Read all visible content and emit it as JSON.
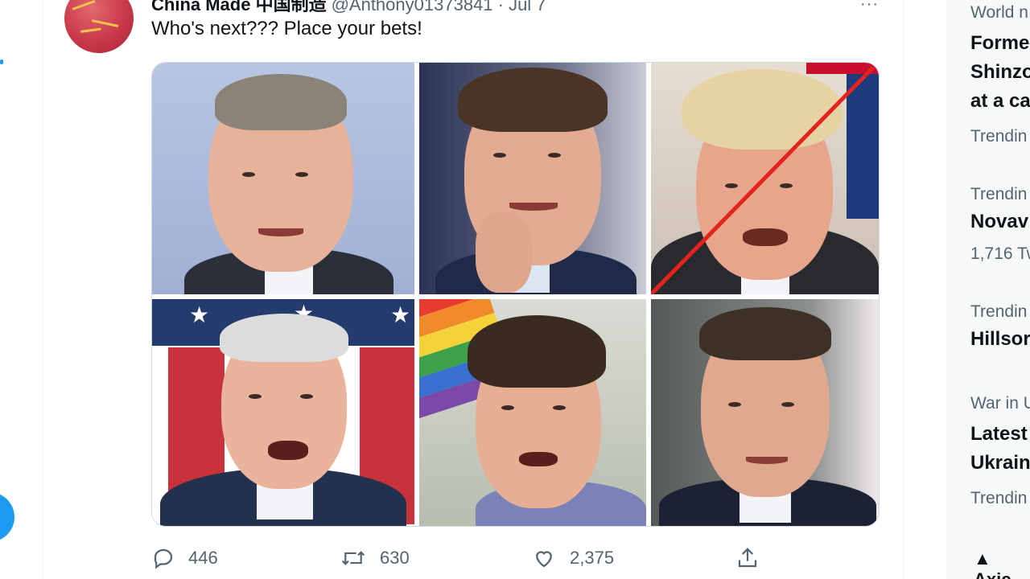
{
  "tweet": {
    "author_name": "China Made 中国制造",
    "author_handle": "@Anthony01373841 · Jul 7",
    "text": "Who's next??? Place your bets!",
    "more_glyph": "···",
    "avatar_icon": "flag-avatar-icon"
  },
  "media": {
    "cells": 6,
    "crossed_out_cell": 3,
    "strike_color": "#e3231d"
  },
  "actions": {
    "reply_count": "446",
    "retweet_count": "630",
    "like_count": "2,375",
    "icons": [
      "reply-icon",
      "retweet-icon",
      "like-icon",
      "share-icon"
    ]
  },
  "sidebar": {
    "trend1_meta": "World n",
    "trend1_title_l1": "Forme",
    "trend1_title_l2": "Shinzo",
    "trend1_title_l3": "at a ca",
    "trend1_footer": "Trendin",
    "trend2_meta": "Trendin",
    "trend2_title": "Novav",
    "trend2_footer": "1,716 Tw",
    "trend3_meta": "Trendin",
    "trend3_title": "Hillsor",
    "trend4_meta": "War in U",
    "trend4_title_l1": "Latest",
    "trend4_title_l2": "Ukrain",
    "trend4_footer": "Trendin",
    "source_label": "Axic"
  },
  "colors": {
    "accent": "#1d9bf0",
    "text_primary": "#0f1419",
    "text_secondary": "#536471"
  }
}
